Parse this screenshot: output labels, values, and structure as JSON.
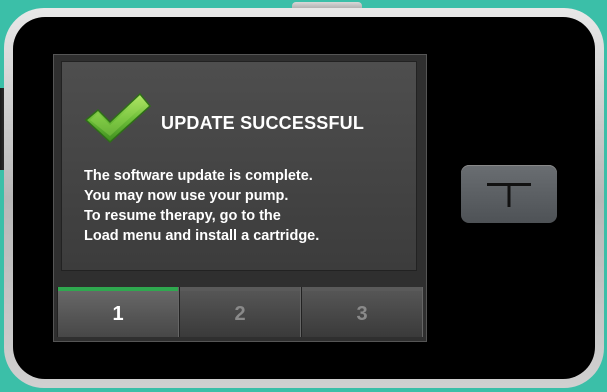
{
  "dialog": {
    "title": "UPDATE SUCCESSFUL",
    "message_lines": [
      "The software update is complete.",
      "You may now use your pump.",
      "To resume therapy, go to the",
      "Load menu and install a cartridge."
    ]
  },
  "tabs": [
    {
      "label": "1",
      "active": true
    },
    {
      "label": "2",
      "active": false
    },
    {
      "label": "3",
      "active": false
    }
  ],
  "colors": {
    "background": "#3bbfa8",
    "success_check": "#6fbf3a",
    "active_tab_indicator": "#2fa84f"
  },
  "icons": {
    "status": "checkmark-icon",
    "home": "t-logo-icon"
  }
}
